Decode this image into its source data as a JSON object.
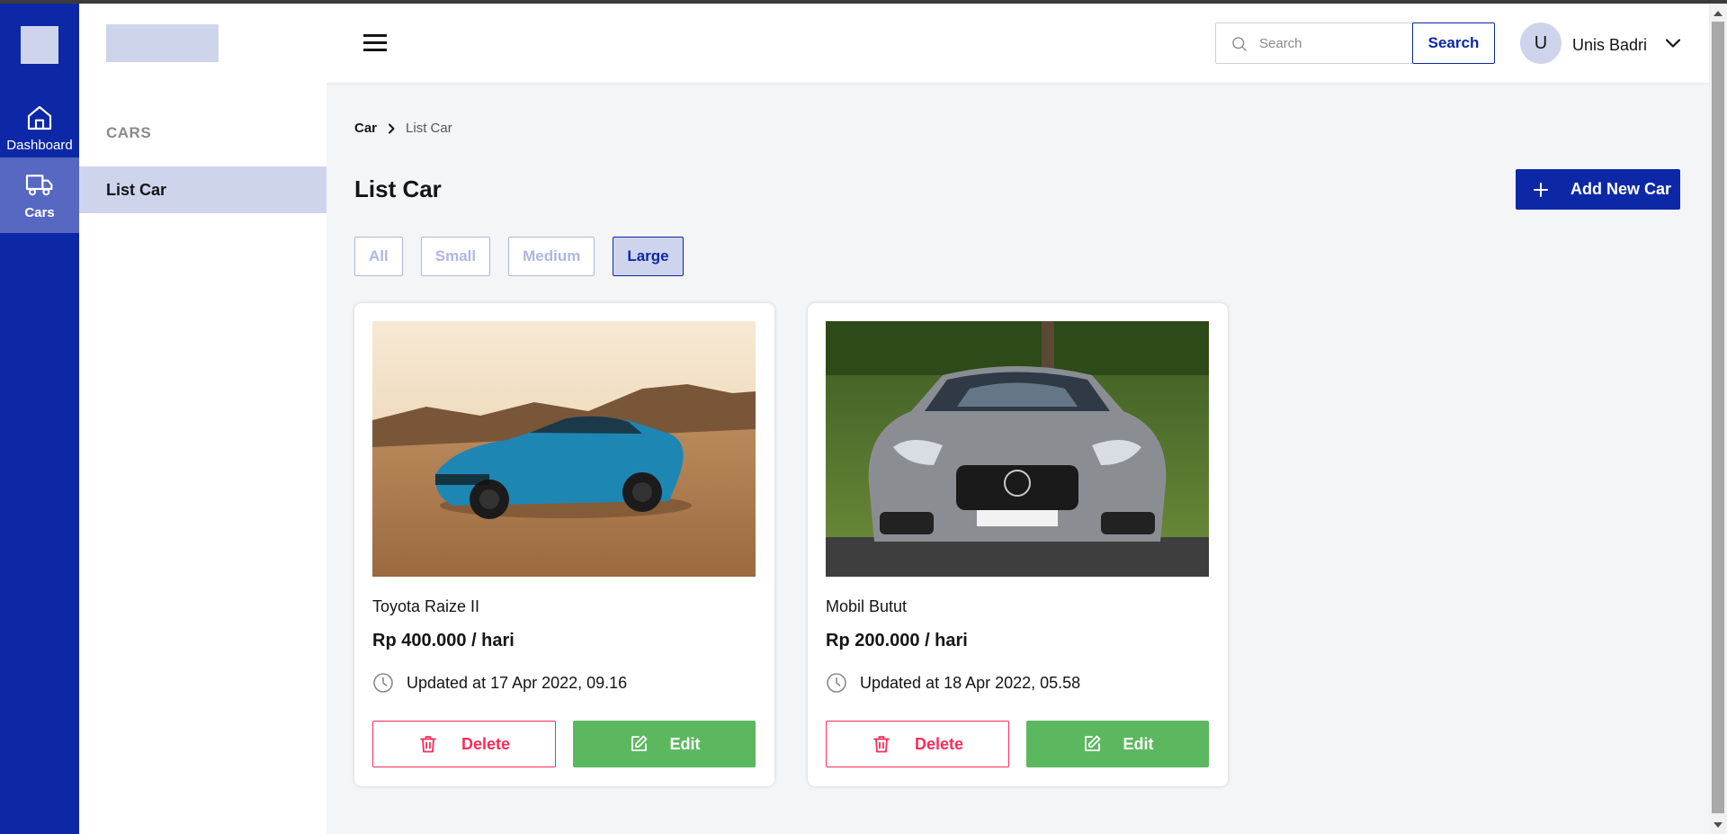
{
  "rail": {
    "items": [
      {
        "label": "Dashboard",
        "icon": "home-icon"
      },
      {
        "label": "Cars",
        "icon": "truck-icon"
      }
    ]
  },
  "header": {
    "search": {
      "placeholder": "Search",
      "button_label": "Search"
    },
    "user": {
      "initial": "U",
      "name": "Unis Badri"
    }
  },
  "subnav": {
    "title": "CARS",
    "items": [
      {
        "label": "List Car"
      }
    ]
  },
  "breadcrumb": [
    "Car",
    "List Car"
  ],
  "page": {
    "title": "List Car",
    "add_button_label": "Add New Car"
  },
  "filters": {
    "options": [
      "All",
      "Small",
      "Medium",
      "Large"
    ],
    "active": "Large"
  },
  "cars": [
    {
      "name": "Toyota Raize II",
      "price": "Rp 400.000 / hari",
      "updated": "Updated at 17 Apr 2022, 09.16",
      "delete_label": "Delete",
      "edit_label": "Edit"
    },
    {
      "name": "Mobil Butut",
      "price": "Rp 200.000 / hari",
      "updated": "Updated at 18 Apr 2022, 05.58",
      "delete_label": "Delete",
      "edit_label": "Edit"
    }
  ],
  "colors": {
    "primary": "#0D28A6",
    "primary_light": "#CFD4ED",
    "danger": "#FA2C5A",
    "success": "#5CB85F"
  }
}
